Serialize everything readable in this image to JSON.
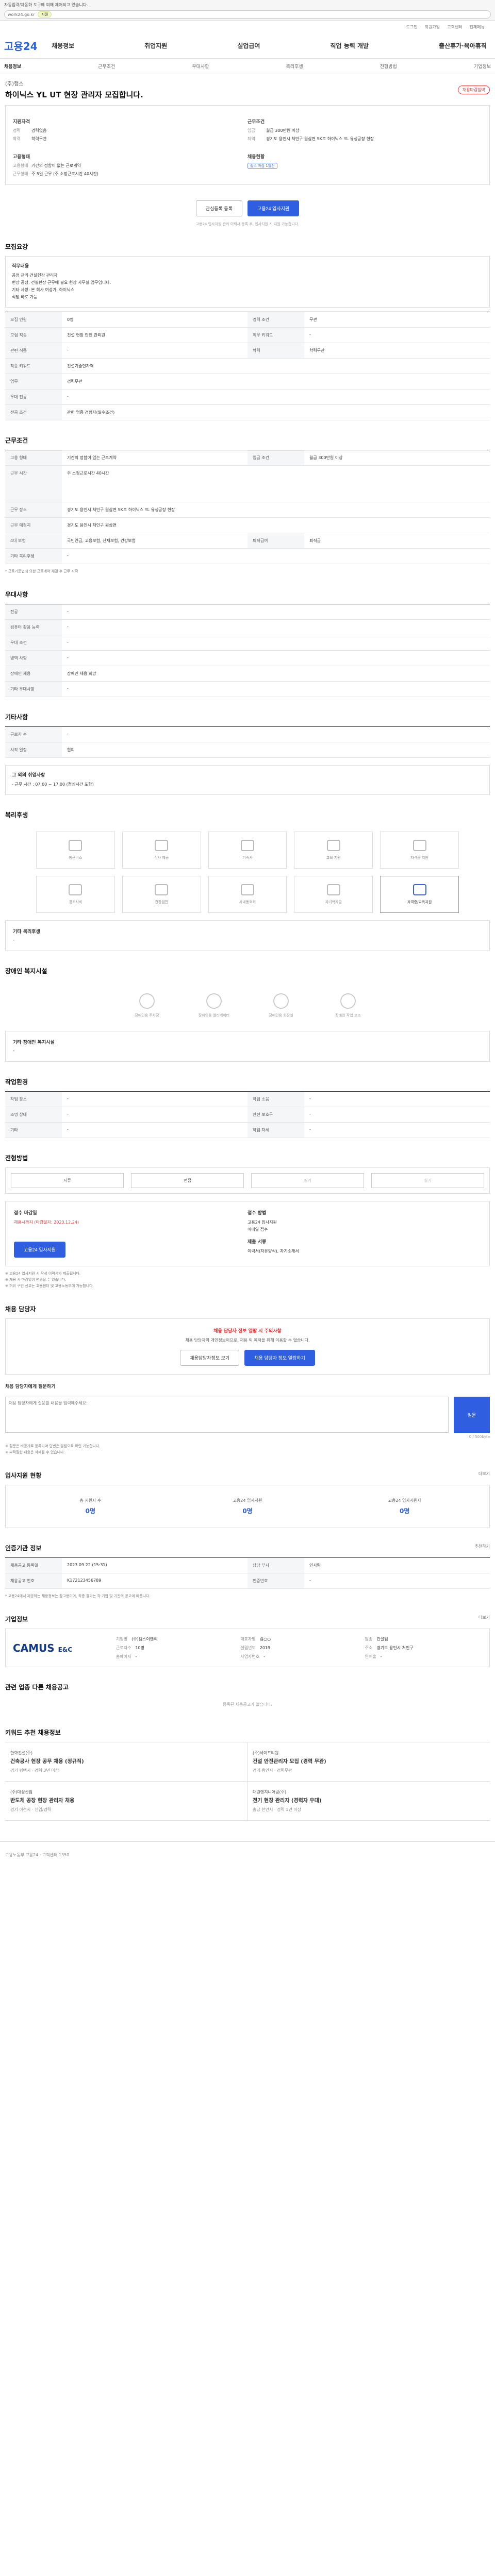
{
  "browser": {
    "note": "자동입력/자동화 도구에 의해 제어되고 있습니다.",
    "url": "work24.go.kr",
    "url_badge": "지원"
  },
  "util": [
    "로그인",
    "회원가입",
    "고객센터",
    "전체메뉴"
  ],
  "logo": "고용24",
  "gnb": [
    "채용정보",
    "취업지원",
    "실업급여",
    "직업 능력 개발",
    "출산휴가·육아휴직"
  ],
  "subnav": [
    "채용정보",
    "근무조건",
    "우대사항",
    "복리후생",
    "전형방법",
    "기업정보"
  ],
  "header": {
    "company": "(주)캠스",
    "title": "하이닉스 YL UT 현장 관리자 모집합니다.",
    "badge": "채용마감임박"
  },
  "summary": {
    "left_head": "지원자격",
    "left_rows": [
      [
        "경력",
        "경력없음"
      ],
      [
        "학력",
        "학력무관"
      ]
    ],
    "left_head2": "고용형태",
    "left_rows2": [
      [
        "고용형태",
        "기간의 정함이 없는 근로계약"
      ],
      [
        "근무형태",
        "주 5일 근무 (주 소정근로시간 40시간)"
      ]
    ],
    "right_head": "근무조건",
    "right_rows": [
      [
        "임금",
        "월급 300만원 이상"
      ],
      [
        "지역",
        "경기도 용인시 처인구 원삼면 SK로 하이닉스 YL 유성공장 현장"
      ]
    ],
    "right_head2": "채용현황",
    "right_badge": "접수 마감 1일전"
  },
  "actions": {
    "scrap": "관심등록 등록",
    "apply": "고용24 입사지원"
  },
  "action_note": "고용24 입사지원 관리 이력서 등록 후, 입사지원 시 지원 가능합니다.",
  "sec_recruit": {
    "title": "모집요강",
    "job_desc_title": "직무내용",
    "job_desc": "공정 관리·건설현장 관리자\n현장 공정, 건설현장 근무에 필요 현장 사무실 업무입니다.\n기타 사항: 본 회사 여성가, 하이닉스\n식당 바로 가능",
    "rows": [
      [
        "모집 인원",
        "0명"
      ],
      [
        "모집 직종",
        "건설 현장 안전 관리원"
      ],
      [
        "관련 직종",
        "-"
      ],
      [
        "직종 키워드",
        "건설기술인자격"
      ],
      [
        "업무",
        "경력무관"
      ],
      [
        "우대 전공",
        "-"
      ],
      [
        "전공 조건",
        "관련 업종 경험자(필수조건)"
      ]
    ],
    "rows_right": [
      [
        "경력 조건",
        "무관"
      ],
      [
        "직무 키워드",
        "-"
      ],
      [
        "학력",
        "학력무관"
      ]
    ]
  },
  "sec_work": {
    "title": "근무조건",
    "rows": [
      [
        "고용 형태",
        "기간의 정함이 없는 근로계약"
      ],
      [
        "임금 조건",
        "월급 300만원 이상"
      ],
      [
        "근무 시간",
        "주 소정근로시간 40시간"
      ],
      [
        "근무 장소",
        "경기도 용인시 처인구 원삼면 SK로 하이닉스 YL 유성공장 현장"
      ],
      [
        "근무 예정지",
        "경기도 용인시 처인구 원삼면"
      ],
      [
        "4대 보험",
        "국민연금, 고용보험, 산재보험, 건강보험"
      ],
      [
        "퇴직급여",
        "퇴직금"
      ],
      [
        "기타 복리후생",
        "-"
      ]
    ],
    "row_note": "* 근로기준법에 의한 근로계약 체결 후 근무 시작"
  },
  "sec_pref": {
    "title": "우대사항",
    "rows": [
      [
        "전공",
        "-"
      ],
      [
        "컴퓨터 활용 능력",
        "-"
      ],
      [
        "우대 조건",
        "-"
      ],
      [
        "병역 사항",
        "-"
      ],
      [
        "장애인 채용",
        "장애인 채용 희망"
      ],
      [
        "기타 우대사항",
        "-"
      ]
    ]
  },
  "sec_etc": {
    "title": "기타사항",
    "rows": [
      [
        "근로자 수",
        "-"
      ],
      [
        "시작 일정",
        "협의"
      ]
    ],
    "extra_title": "그 외의 취업사항",
    "extra": "- 근무 시간 : 07:00 ~ 17:00 (점심시간 포함)"
  },
  "sec_welfare": {
    "title": "복리후생",
    "items": [
      "통근버스",
      "식사 제공",
      "기숙사",
      "교육 지원",
      "자격증 지원",
      "경조사비",
      "건강검진",
      "사내동호회",
      "자녀학자금",
      "자격증/교육지원"
    ],
    "active": 9,
    "etc_title": "기타 복리후생",
    "etc": "-"
  },
  "sec_disabled": {
    "title": "장애인 복지시설",
    "items": [
      "장애인용 주차장",
      "장애인용 엘리베이터",
      "장애인용 화장실",
      "장애인 작업 보조"
    ],
    "etc_title": "기타 장애인 복지시설",
    "etc": "-"
  },
  "sec_workenv": {
    "title": "작업환경",
    "rows": [
      [
        "작업 장소",
        "-",
        "작업 소음",
        "-"
      ],
      [
        "조명 상태",
        "-",
        "안전 보호구",
        "-"
      ],
      [
        "기타",
        "-",
        "작업 자세",
        "-"
      ]
    ]
  },
  "sec_select": {
    "title": "전형방법",
    "items": [
      "서류",
      "면접",
      "필기",
      "실기"
    ],
    "apply_title": "접수 마감일",
    "apply_date": "채용시까지 (마감일자: 2023.12.24)",
    "method_title": "접수 방법",
    "methods": [
      "고용24 입사지원",
      "이메일 접수"
    ],
    "docs_title": "제출 서류",
    "docs": "이력서(자유양식), 자기소개서",
    "apply_btn": "고용24 입사지원",
    "notes": [
      "※ 고용24 입사지원 시 작성 이력서가 제출됩니다.",
      "※ 채용 시 마감일이 변경될 수 있습니다.",
      "※ 허위 구인 신고는 고용센터 및 고용노동부에 가능합니다."
    ]
  },
  "sec_mgr": {
    "title": "채용 담당자",
    "warn": "채용 담당자 정보 열람 시 주의사항",
    "warn_desc": "채용 담당자의 개인정보이므로, 채용 외 목적을 위해 이용할 수 없습니다.",
    "btn1": "채용담당자정보 보기",
    "btn2": "채용 담당자 정보 열람하기",
    "q_title": "채용 담당자에게 질문하기",
    "q_placeholder": "채용 담당자에게 질문할 내용을 입력해주세요.",
    "q_count": "0 / 500byte",
    "send": "질문",
    "notes": [
      "※ 질문은 비공개로 등록되며 답변은 알림으로 확인 가능합니다.",
      "※ 부적절한 내용은 삭제될 수 있습니다."
    ]
  },
  "sec_stat": {
    "title": "입사지원 현황",
    "more": "더보기",
    "items": [
      [
        "총 지원자 수",
        "0명"
      ],
      [
        "고용24 입사지원",
        "0명"
      ],
      [
        "고용24 입사지원자",
        "0명"
      ]
    ]
  },
  "sec_info": {
    "title": "인증기관 정보",
    "btn": "추천하기",
    "rows": [
      [
        "채용공고 등록일",
        "2023.09.22 (15:31)",
        "담당 부서",
        "인사팀"
      ],
      [
        "채용공고 번호",
        "K172123456789",
        "인증번호",
        "-"
      ]
    ],
    "note": "* 고용24에서 제공하는 채용정보는 참고용이며, 최종 결과는 각 기업 및 기관의 공고에 따릅니다."
  },
  "sec_company": {
    "title": "기업정보",
    "more": "더보기",
    "logo": "CAMUS",
    "logo_sub": "E&C",
    "rows": [
      [
        "기업명",
        "(주)캠스이앤씨"
      ],
      [
        "대표자명",
        "김○○"
      ],
      [
        "업종",
        "건설업"
      ],
      [
        "근로자수",
        "10명"
      ],
      [
        "설립년도",
        "2019"
      ],
      [
        "주소",
        "경기도 용인시 처인구"
      ],
      [
        "홈페이지",
        "-"
      ],
      [
        "사업자번호",
        "-"
      ],
      [
        "연매출",
        "-"
      ]
    ]
  },
  "sec_similar": {
    "title": "관련 업종 다른 채용공고",
    "note": "등록된 채용공고가 없습니다."
  },
  "sec_reco": {
    "title": "키워드 추천 채용정보",
    "cards": [
      {
        "company": "한화건설(주)",
        "title": "건축공사 현장 공무 채용 (정규직)",
        "meta": "경기 평택시 · 경력 3년 이상"
      },
      {
        "company": "(주)세이프티원",
        "title": "건설 안전관리자 모집 (경력 무관)",
        "meta": "경기 용인시 · 경력무관"
      },
      {
        "company": "(주)대성산업",
        "title": "반도체 공장 현장 관리자 채용",
        "meta": "경기 이천시 · 신입/경력"
      },
      {
        "company": "대원엔지니어링(주)",
        "title": "전기 현장 관리자 (경력자 우대)",
        "meta": "충남 천안시 · 경력 1년 이상"
      }
    ]
  },
  "footer": "고용노동부 고용24 · 고객센터 1350"
}
